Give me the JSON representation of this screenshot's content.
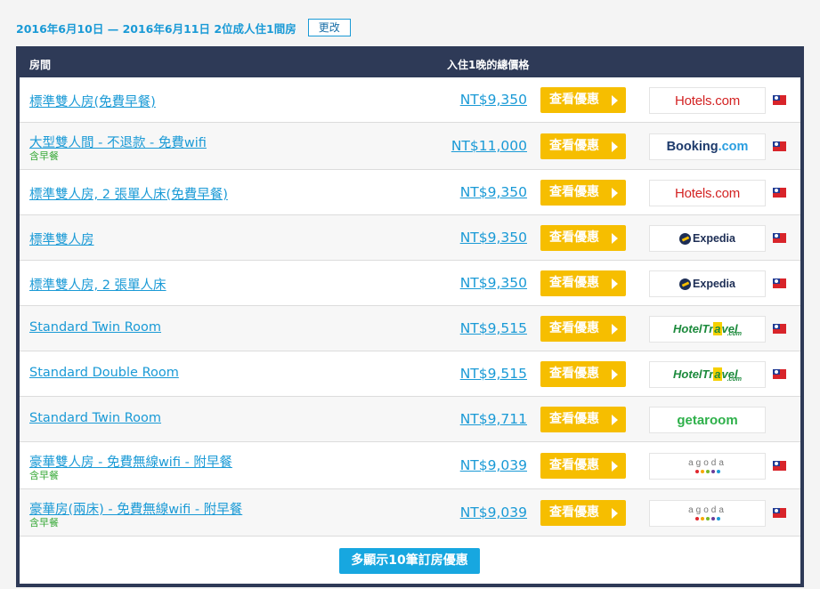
{
  "search": {
    "dates": "2016年6月10日 — 2016年6月11日 2位成人住1間房",
    "change_label": "更改"
  },
  "table": {
    "header_room": "房間",
    "header_price": "入住1晚的總價格",
    "deal_label": "查看優惠",
    "rows": [
      {
        "room": "標準雙人房(免費早餐)",
        "sub": "",
        "price": "NT$9,350",
        "provider": "Hotels.com",
        "flag": true
      },
      {
        "room": "大型雙人間 - 不退款 - 免費wifi",
        "sub": "含早餐",
        "price": "NT$11,000",
        "provider": "Booking.com",
        "flag": true
      },
      {
        "room": "標準雙人房, 2 張單人床(免費早餐)",
        "sub": "",
        "price": "NT$9,350",
        "provider": "Hotels.com",
        "flag": true
      },
      {
        "room": "標準雙人房",
        "sub": "",
        "price": "NT$9,350",
        "provider": "Expedia",
        "flag": true
      },
      {
        "room": "標準雙人房, 2 張單人床",
        "sub": "",
        "price": "NT$9,350",
        "provider": "Expedia",
        "flag": true
      },
      {
        "room": "Standard Twin Room",
        "sub": "",
        "price": "NT$9,515",
        "provider": "HotelTravel.com",
        "flag": true
      },
      {
        "room": "Standard Double Room",
        "sub": "",
        "price": "NT$9,515",
        "provider": "HotelTravel.com",
        "flag": true
      },
      {
        "room": "Standard Twin Room",
        "sub": "",
        "price": "NT$9,711",
        "provider": "getaroom",
        "flag": false
      },
      {
        "room": "豪華雙人房 - 免費無線wifi - 附早餐",
        "sub": "含早餐",
        "price": "NT$9,039",
        "provider": "agoda",
        "flag": true
      },
      {
        "room": "豪華房(兩床) - 免費無線wifi - 附早餐",
        "sub": "含早餐",
        "price": "NT$9,039",
        "provider": "agoda",
        "flag": true
      }
    ],
    "more_label": "多顯示10筆訂房優惠"
  },
  "logos": {
    "hotels": {
      "text": "Hotels.com",
      "icon": "hotels-com-logo"
    },
    "booking": {
      "text": "Booking",
      "suffix": ".com",
      "icon": "booking-com-logo"
    },
    "expedia": {
      "text": "Expedia",
      "icon": "expedia-logo"
    },
    "hoteltravel": {
      "text_a": "HotelTr",
      "text_y": "a",
      "text_b": "vel",
      "suffix": ".com",
      "icon": "hoteltravel-logo"
    },
    "getaroom": {
      "text": "getaroom",
      "icon": "getaroom-logo"
    },
    "agoda": {
      "text": "agoda",
      "icon": "agoda-logo",
      "dot_colors": [
        "#e0262d",
        "#f6a800",
        "#76b82a",
        "#6a3d9a",
        "#1a9ad6"
      ]
    }
  },
  "colors": {
    "accent": "#1a9ad6",
    "header_bg": "#2e3a57",
    "deal_button": "#f6be00",
    "more_button": "#17a7e0",
    "breakfast": "#3aaa3a"
  }
}
